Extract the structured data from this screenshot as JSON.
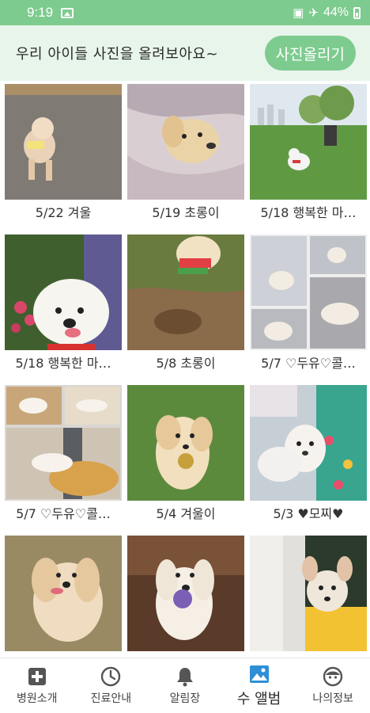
{
  "status_bar": {
    "time": "9:19",
    "battery": "44%"
  },
  "header": {
    "message": "우리 아이들 사진을 올려보아요~",
    "upload_button": "사진올리기"
  },
  "album": [
    {
      "caption": "5/22 겨울"
    },
    {
      "caption": "5/19 초롱이"
    },
    {
      "caption": "5/18 행복한 마…"
    },
    {
      "caption": "5/18 행복한 마…"
    },
    {
      "caption": "5/8 초롱이"
    },
    {
      "caption": "5/7 ♡두유♡콜…"
    },
    {
      "caption": "5/7 ♡두유♡콜…"
    },
    {
      "caption": "5/4 겨울이"
    },
    {
      "caption": "5/3 ♥모찌♥"
    },
    {
      "caption": ""
    },
    {
      "caption": ""
    },
    {
      "caption": ""
    }
  ],
  "bottom_nav": [
    {
      "label": "병원소개",
      "icon": "hospital-plus-icon"
    },
    {
      "label": "진료안내",
      "icon": "clock-icon"
    },
    {
      "label": "알림장",
      "icon": "bell-icon"
    },
    {
      "label": "앨범",
      "icon": "image-icon",
      "prefix": "수",
      "active": true
    },
    {
      "label": "나의정보",
      "icon": "face-icon"
    }
  ],
  "colors": {
    "accent": "#7ecb8f",
    "header_bg": "#e8f5eb"
  }
}
